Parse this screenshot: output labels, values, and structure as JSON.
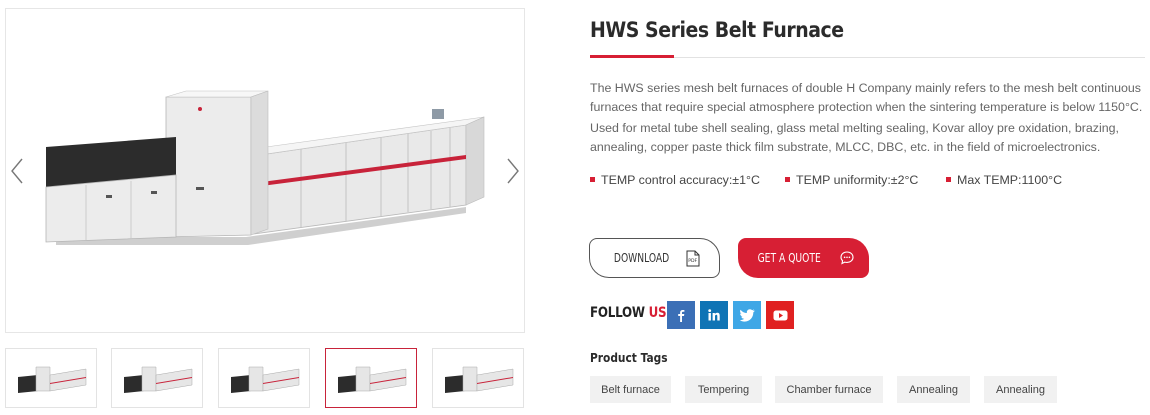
{
  "product": {
    "title": "HWS Series Belt Furnace",
    "description": [
      "The HWS series mesh belt furnaces of double H Company mainly refers to the mesh belt continuous furnaces that require special atmosphere protection when the sintering temperature is below 1150°C.",
      "Used for metal tube shell sealing, glass metal melting sealing, Kovar alloy pre oxidation, brazing, annealing, copper paste thick film substrate, MLCC, DBC, etc. in the field of microelectronics."
    ],
    "specs": [
      "TEMP control accuracy:±1°C",
      "TEMP uniformity:±2°C",
      "Max TEMP:1100°C"
    ]
  },
  "gallery": {
    "thumbnail_count": 5,
    "active_thumbnail": 4
  },
  "buttons": {
    "download_label": "DOWNLOAD",
    "download_icon": "pdf-icon",
    "quote_label": "GET A QUOTE",
    "quote_icon": "chat-bubble-icon"
  },
  "follow": {
    "label": "FOLLOW",
    "label_accent": "US",
    "networks": [
      "facebook-icon",
      "linkedin-icon",
      "twitter-icon",
      "youtube-icon"
    ]
  },
  "tags": {
    "title": "Product Tags",
    "items": [
      "Belt furnace",
      "Tempering",
      "Chamber furnace",
      "Annealing",
      "Annealing"
    ]
  },
  "colors": {
    "accent": "#d71f34",
    "facebook": "#3b6fb6",
    "linkedin": "#0f74b5",
    "twitter": "#3fa7e6",
    "youtube": "#e02121"
  }
}
